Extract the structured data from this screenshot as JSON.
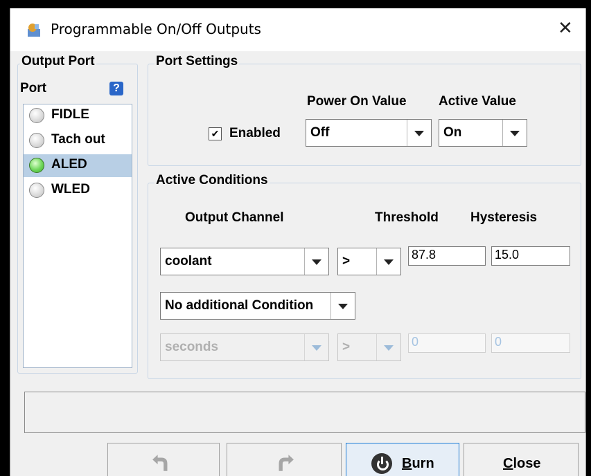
{
  "window": {
    "title": "Programmable On/Off Outputs",
    "close_glyph": "✕"
  },
  "output_port": {
    "legend": "Output Port",
    "port_label": "Port",
    "help_glyph": "?",
    "ports": [
      {
        "label": "FIDLE",
        "active": false,
        "selected": false
      },
      {
        "label": "Tach out",
        "active": false,
        "selected": false
      },
      {
        "label": "ALED",
        "active": true,
        "selected": true
      },
      {
        "label": "WLED",
        "active": false,
        "selected": false
      }
    ]
  },
  "port_settings": {
    "legend": "Port Settings",
    "enabled_label": "Enabled",
    "enabled_checked": true,
    "check_glyph": "✔",
    "power_on_value_label": "Power On Value",
    "power_on_value": "Off",
    "active_value_label": "Active Value",
    "active_value": "On"
  },
  "active_conditions": {
    "legend": "Active Conditions",
    "col_output_channel": "Output Channel",
    "col_threshold": "Threshold",
    "col_hysteresis": "Hysteresis",
    "channel": "coolant",
    "operator": ">",
    "threshold": "87.8",
    "hysteresis": "15.0",
    "additional_condition": "No additional Condition",
    "second_channel": "seconds",
    "second_operator": ">",
    "second_threshold": "0",
    "second_hysteresis": "0"
  },
  "footer": {
    "burn_label_underlined": "B",
    "burn_label_rest": "urn",
    "close_label_underlined": "C",
    "close_label_rest": "lose"
  },
  "colors": {
    "selection": "#b8cfe5",
    "led_on": "#6ed65a",
    "help_icon": "#2a66c8",
    "primary_border": "#1a7ad4"
  }
}
